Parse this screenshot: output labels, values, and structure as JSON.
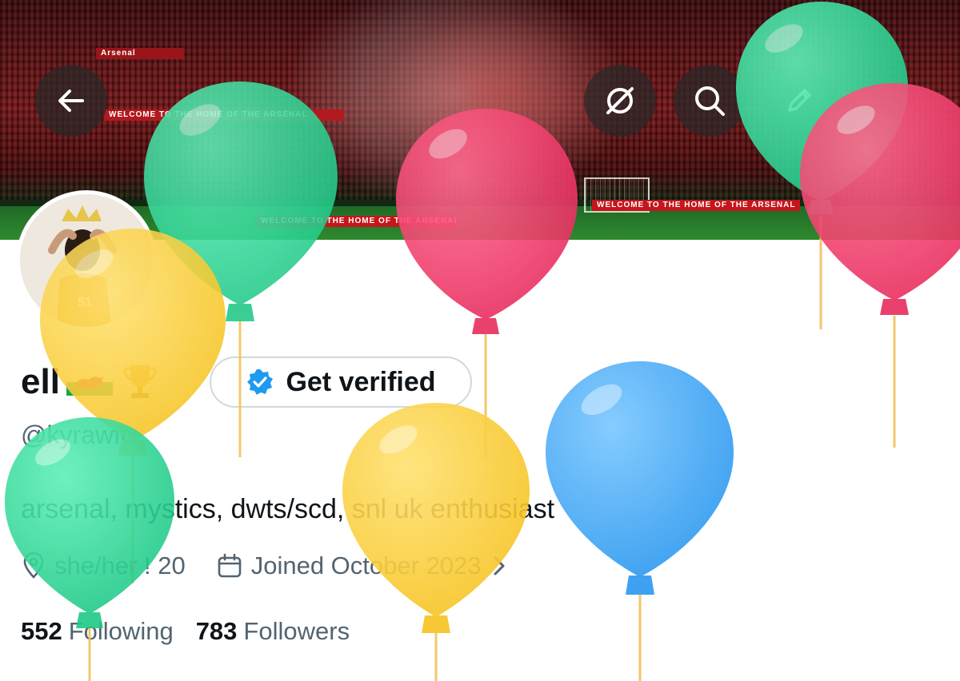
{
  "header": {
    "banner_board_text": "WELCOME TO THE HOME OF THE ARSENAL",
    "banner_brand": "Arsenal",
    "buttons": {
      "back_icon": "arrow-left-icon",
      "noframe_icon": "no-frame-icon",
      "search_icon": "search-icon",
      "edit_icon": "pencil-icon"
    }
  },
  "profile": {
    "display_name": "ell",
    "name_emojis": [
      "welsh-flag",
      "trophy"
    ],
    "verify_label": "Get verified",
    "handle": "@kyrawfc",
    "bio": "arsenal, mystics, dwts/scd, snl uk enthusiast",
    "meta": {
      "location": "she/her ! 20",
      "joined": "Joined October 2023"
    },
    "stats": {
      "following_count": "552",
      "following_label": "Following",
      "followers_count": "783",
      "followers_label": "Followers"
    }
  },
  "colors": {
    "verified_blue": "#1d9bf0",
    "balloon_green": "#2fd99a",
    "balloon_red": "#f03e6a",
    "balloon_yellow": "#fcd03a",
    "balloon_blue": "#4aaef7",
    "string": "#f3c25a"
  }
}
